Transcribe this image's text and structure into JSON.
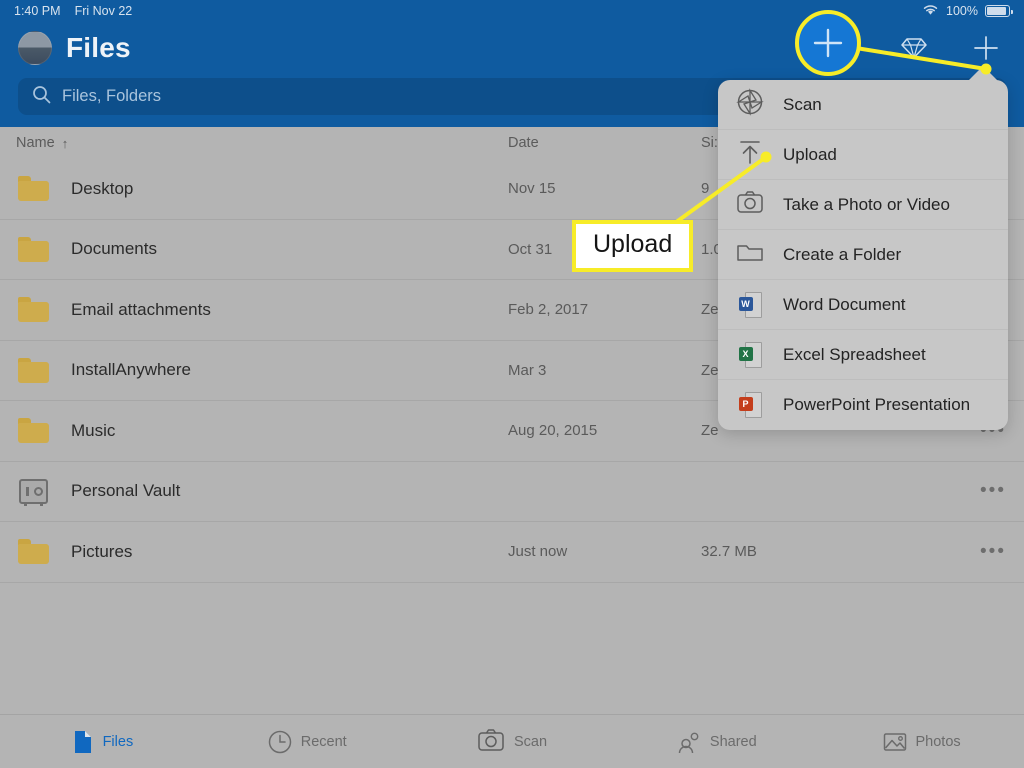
{
  "statusbar": {
    "time": "1:40 PM",
    "date": "Fri Nov 22",
    "wifi_icon": "wifi-icon",
    "battery_percent": "100%",
    "battery_icon": "battery-icon"
  },
  "header": {
    "avatar_icon": "avatar",
    "title": "Files",
    "premium_icon": "diamond-icon",
    "add_icon": "plus-icon"
  },
  "search": {
    "icon": "search-icon",
    "placeholder": "Files, Folders",
    "value": ""
  },
  "list_header": {
    "name": "Name",
    "sort_arrow": "↑",
    "date": "Date",
    "size": "Si:"
  },
  "rows": [
    {
      "icon": "folder-icon",
      "name": "Desktop",
      "date": "Nov 15",
      "size": "9",
      "more": "•••"
    },
    {
      "icon": "folder-icon",
      "name": "Documents",
      "date": "Oct 31",
      "size": "1.0",
      "more": "•••"
    },
    {
      "icon": "folder-icon",
      "name": "Email attachments",
      "date": "Feb 2, 2017",
      "size": "Ze",
      "more": "•••"
    },
    {
      "icon": "folder-icon",
      "name": "InstallAnywhere",
      "date": "Mar 3",
      "size": "Ze",
      "more": "•••"
    },
    {
      "icon": "folder-icon",
      "name": "Music",
      "date": "Aug 20, 2015",
      "size": "Ze",
      "more": "•••"
    },
    {
      "icon": "vault-icon",
      "name": "Personal Vault",
      "date": "",
      "size": "",
      "more": "•••"
    },
    {
      "icon": "folder-icon",
      "name": "Pictures",
      "date": "Just now",
      "size": "32.7 MB",
      "more": "•••"
    }
  ],
  "menu": {
    "items": [
      {
        "icon": "scan-icon",
        "label": "Scan"
      },
      {
        "icon": "upload-icon",
        "label": "Upload"
      },
      {
        "icon": "camera-icon",
        "label": "Take a Photo or Video"
      },
      {
        "icon": "new-folder-icon",
        "label": "Create a Folder"
      },
      {
        "icon": "word-icon",
        "label": "Word Document",
        "badge": "W",
        "badge_color": "#2b579a"
      },
      {
        "icon": "excel-icon",
        "label": "Excel Spreadsheet",
        "badge": "X",
        "badge_color": "#217346"
      },
      {
        "icon": "powerpoint-icon",
        "label": "PowerPoint Presentation",
        "badge": "P",
        "badge_color": "#c43e1c"
      }
    ]
  },
  "annotation": {
    "callout_label": "Upload",
    "highlight_color": "#f7ec28",
    "highlighted_control": "add-button"
  },
  "tabbar": {
    "tabs": [
      {
        "icon": "document-icon",
        "label": "Files",
        "active": true
      },
      {
        "icon": "clock-icon",
        "label": "Recent",
        "active": false
      },
      {
        "icon": "camera-icon",
        "label": "Scan",
        "active": false
      },
      {
        "icon": "people-icon",
        "label": "Shared",
        "active": false
      },
      {
        "icon": "photo-icon",
        "label": "Photos",
        "active": false
      }
    ]
  },
  "colors": {
    "chrome_blue": "#0f5ba0",
    "search_blue": "#0d4f8b",
    "page_gray": "#b4b4b4",
    "menu_gray": "#c7c7c7",
    "accent_yellow": "#f7ec28",
    "folder_gold": "#ceac4d",
    "active_tab_blue": "#1068c0"
  }
}
